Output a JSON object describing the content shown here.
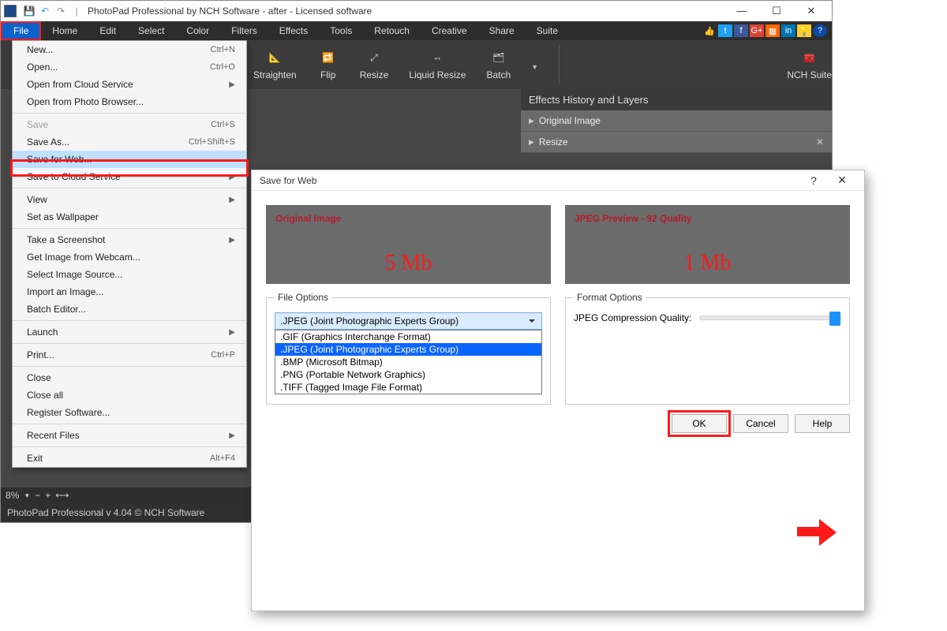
{
  "titlebar": {
    "title": "PhotoPad Professional by NCH Software - after - Licensed software"
  },
  "menubar": {
    "items": [
      "File",
      "Home",
      "Edit",
      "Select",
      "Color",
      "Filters",
      "Effects",
      "Tools",
      "Retouch",
      "Creative",
      "Share",
      "Suite"
    ],
    "active_index": 0
  },
  "social_icons": [
    "like",
    "tw",
    "fb",
    "gp",
    "sh",
    "in",
    "bulb",
    "q"
  ],
  "ribbon": {
    "buttons": [
      "Straighten",
      "Flip",
      "Resize",
      "Liquid Resize",
      "Batch"
    ],
    "suite": "NCH Suite"
  },
  "side_panel": {
    "title": "Effects History and Layers",
    "rows": [
      "Original Image",
      "Resize"
    ]
  },
  "zoom": {
    "value": "8%"
  },
  "statusbar": {
    "text": "PhotoPad Professional v 4.04 © NCH Software"
  },
  "file_menu": {
    "groups": [
      [
        {
          "label": "New...",
          "shortcut": "Ctrl+N"
        },
        {
          "label": "Open...",
          "shortcut": "Ctrl+O"
        },
        {
          "label": "Open from Cloud Service",
          "submenu": true
        },
        {
          "label": "Open from Photo Browser..."
        }
      ],
      [
        {
          "label": "Save",
          "shortcut": "Ctrl+S",
          "disabled": true
        },
        {
          "label": "Save As...",
          "shortcut": "Ctrl+Shift+S"
        },
        {
          "label": "Save for Web...",
          "highlight": true
        },
        {
          "label": "Save to Cloud Service",
          "submenu": true
        }
      ],
      [
        {
          "label": "View",
          "submenu": true
        },
        {
          "label": "Set as Wallpaper"
        }
      ],
      [
        {
          "label": "Take a Screenshot",
          "submenu": true
        },
        {
          "label": "Get Image from Webcam..."
        },
        {
          "label": "Select Image Source..."
        },
        {
          "label": "Import an Image..."
        },
        {
          "label": "Batch Editor..."
        }
      ],
      [
        {
          "label": "Launch",
          "submenu": true
        }
      ],
      [
        {
          "label": "Print...",
          "shortcut": "Ctrl+P"
        }
      ],
      [
        {
          "label": "Close"
        },
        {
          "label": "Close all"
        },
        {
          "label": "Register Software..."
        }
      ],
      [
        {
          "label": "Recent Files",
          "submenu": true
        }
      ],
      [
        {
          "label": "Exit",
          "shortcut": "Alt+F4"
        }
      ]
    ]
  },
  "dialog": {
    "title": "Save for Web",
    "original": {
      "title": "Original Image",
      "size": "5 Mb"
    },
    "preview": {
      "title": "JPEG Preview - 92 Quality",
      "size": "1 Mb"
    },
    "file_options_label": "File Options",
    "format_options_label": "Format Options",
    "combo_selected": ".JPEG (Joint Photographic Experts Group)",
    "format_list": [
      ".GIF (Graphics Interchange Format)",
      ".JPEG (Joint Photographic Experts Group)",
      ".BMP (Microsoft Bitmap)",
      ".PNG (Portable Network Graphics)",
      ".TIFF (Tagged Image File Format)"
    ],
    "format_selected_index": 1,
    "quality_label": "JPEG Compression Quality:",
    "quality_value": 92,
    "buttons": {
      "ok": "OK",
      "cancel": "Cancel",
      "help": "Help"
    }
  }
}
